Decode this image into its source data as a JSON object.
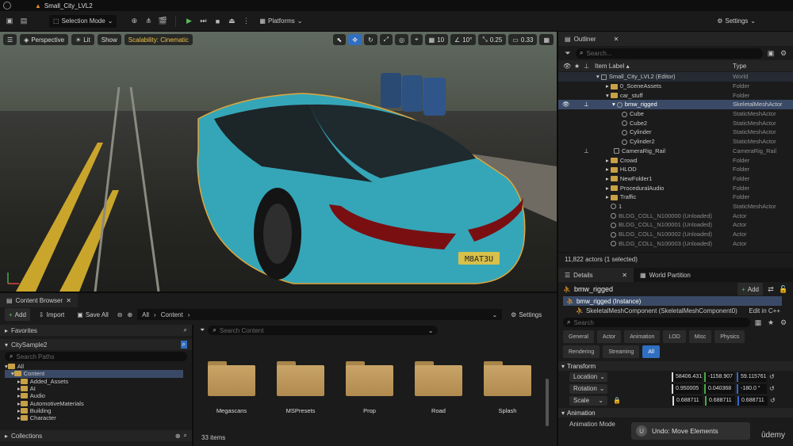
{
  "titlebar": {
    "project_name": "Small_City_LVL2"
  },
  "toolbar": {
    "selection_mode": "Selection Mode",
    "platforms": "Platforms",
    "settings": "Settings"
  },
  "viewport": {
    "perspective": "Perspective",
    "lit": "Lit",
    "show": "Show",
    "scalability": "Scalability: Cinematic",
    "grid_snap": "10",
    "rot_snap": "10°",
    "scale_snap": "0.25",
    "camera_speed": "0.33",
    "plate": "M8AT3U"
  },
  "outliner": {
    "tab": "Outliner",
    "search_placeholder": "Search...",
    "col_label": "Item Label ▴",
    "col_type": "Type",
    "rows": [
      {
        "label": "Small_City_LVL2 (Editor)",
        "type": "World"
      },
      {
        "label": "0_SceneAssets",
        "type": "Folder"
      },
      {
        "label": "car_stuff",
        "type": "Folder"
      },
      {
        "label": "bmw_rigged",
        "type": "SkeletalMeshActor"
      },
      {
        "label": "Cube",
        "type": "StaticMeshActor"
      },
      {
        "label": "Cube2",
        "type": "StaticMeshActor"
      },
      {
        "label": "Cylinder",
        "type": "StaticMeshActor"
      },
      {
        "label": "Cylinder2",
        "type": "StaticMeshActor"
      },
      {
        "label": "CameraRig_Rail",
        "type": "CameraRig_Rail"
      },
      {
        "label": "Crowd",
        "type": "Folder"
      },
      {
        "label": "HLOD",
        "type": "Folder"
      },
      {
        "label": "NewFolder1",
        "type": "Folder"
      },
      {
        "label": "ProceduralAudio",
        "type": "Folder"
      },
      {
        "label": "Traffic",
        "type": "Folder"
      },
      {
        "label": "1",
        "type": "StaticMeshActor"
      },
      {
        "label": "BLDG_COLL_N100000 (Unloaded)",
        "type": "Actor"
      },
      {
        "label": "BLDG_COLL_N100001 (Unloaded)",
        "type": "Actor"
      },
      {
        "label": "BLDG_COLL_N100002 (Unloaded)",
        "type": "Actor"
      },
      {
        "label": "BLDG_COLL_N100003 (Unloaded)",
        "type": "Actor"
      }
    ],
    "status": "11,822 actors (1 selected)"
  },
  "details": {
    "tab": "Details",
    "tab2": "World Partition",
    "actor_name": "bmw_rigged",
    "add": "Add",
    "instance": "bmw_rigged (Instance)",
    "component": "SkeletalMeshComponent (SkeletalMeshComponent0)",
    "edit_cpp": "Edit in C++",
    "search_placeholder": "Search",
    "filters": [
      "General",
      "Actor",
      "Animation",
      "LOD",
      "Misc",
      "Physics",
      "Rendering",
      "Streaming",
      "All"
    ],
    "transform": "Transform",
    "location": {
      "label": "Location",
      "x": "58406.431",
      "y": "-1158.907",
      "z": "59.115761"
    },
    "rotation": {
      "label": "Rotation",
      "x": "0.950005",
      "y": "0.040368",
      "z": "-180.0 °"
    },
    "scale": {
      "label": "Scale",
      "x": "0.688711",
      "y": "0.688711",
      "z": "0.688711"
    },
    "animation": "Animation",
    "animation_mode": "Animation Mode",
    "toast": "Undo: Move Elements",
    "watermark": "ûdemy"
  },
  "content_browser": {
    "tab": "Content Browser",
    "add": "Add",
    "import": "Import",
    "save_all": "Save All",
    "path_all": "All",
    "path_content": "Content",
    "settings": "Settings",
    "favorites": "Favorites",
    "project": "CitySample2",
    "search_paths": "Search Paths",
    "search_content": "Search Content",
    "tree": [
      "All",
      "Content",
      "Added_Assets",
      "AI",
      "Audio",
      "AutomotiveMaterials",
      "Building",
      "Character"
    ],
    "collections": "Collections",
    "folders": [
      "Megascans",
      "MSPresets",
      "Prop",
      "Road",
      "Splash"
    ],
    "count": "33 items"
  }
}
